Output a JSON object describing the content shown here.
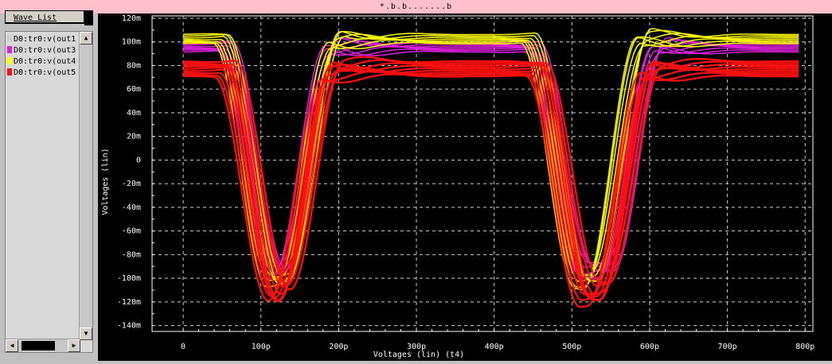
{
  "window": {
    "title": "*.b.b.......b"
  },
  "wave_list": {
    "title": "Wave List",
    "items": [
      {
        "label": "D0:tr0:v(out1",
        "color": "#d0d0d0"
      },
      {
        "label": "D0:tr0:v(out3",
        "color": "#e020e0"
      },
      {
        "label": "D0:tr0:v(out4",
        "color": "#ffff00"
      },
      {
        "label": "D0:tr0:v(out5",
        "color": "#ff1010"
      }
    ],
    "scroll_up_icon": "triangle-up-icon",
    "scroll_down_icon": "triangle-down-icon",
    "scroll_left_icon": "triangle-left-icon",
    "scroll_right_icon": "triangle-right-icon"
  },
  "chart_data": {
    "type": "line",
    "title": "",
    "xlabel": "Voltages (lin) (t4)",
    "ylabel": "Voltages (lin)",
    "xlim": [
      -40,
      810
    ],
    "ylim": [
      -145,
      122
    ],
    "x_unit": "p",
    "y_unit": "m",
    "x_ticks": [
      0,
      100,
      200,
      300,
      400,
      500,
      600,
      700,
      800
    ],
    "x_tick_labels": [
      "0",
      "100p",
      "200p",
      "300p",
      "400p",
      "500p",
      "600p",
      "700p",
      "800p"
    ],
    "y_ticks": [
      120,
      100,
      80,
      60,
      40,
      20,
      0,
      -20,
      -40,
      -60,
      -80,
      -100,
      -120,
      -140
    ],
    "y_tick_labels": [
      "120m",
      "100m",
      "80m",
      "60m",
      "40m",
      "20m",
      "0",
      "-20m",
      "-40m",
      "-60m",
      "-80m",
      "-100m",
      "-120m",
      "-140m"
    ],
    "grid": true,
    "series": [
      {
        "color": "#e020e0",
        "high": 96,
        "low": -92,
        "edges": [
          {
            "t": 0,
            "dir": "hold-high"
          },
          {
            "t": 90,
            "dir": "fall"
          },
          {
            "t": 160,
            "dir": "rise"
          },
          {
            "t": 485,
            "dir": "fall"
          },
          {
            "t": 580,
            "dir": "rise"
          }
        ]
      },
      {
        "color": "#ffff00",
        "high": 103,
        "low": -101,
        "edges": [
          {
            "t": 0,
            "dir": "hold-high"
          },
          {
            "t": 85,
            "dir": "fall"
          },
          {
            "t": 165,
            "dir": "rise"
          },
          {
            "t": 480,
            "dir": "fall"
          },
          {
            "t": 560,
            "dir": "rise"
          }
        ]
      },
      {
        "color": "#ff1010",
        "high": 78,
        "low": -114,
        "edges": [
          {
            "t": 0,
            "dir": "hold-high"
          },
          {
            "t": 90,
            "dir": "fall"
          },
          {
            "t": 160,
            "dir": "rise"
          },
          {
            "t": 490,
            "dir": "fall"
          },
          {
            "t": 570,
            "dir": "rise"
          }
        ]
      }
    ]
  }
}
